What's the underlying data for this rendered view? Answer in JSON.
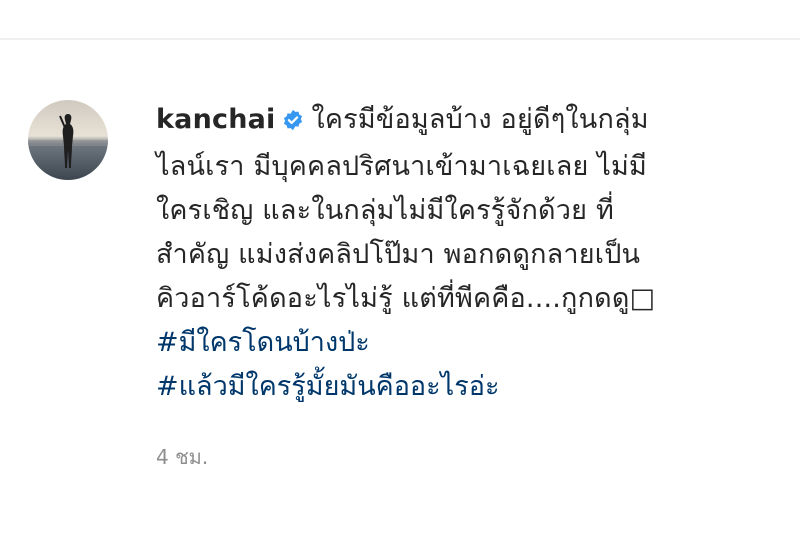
{
  "comment": {
    "username": "kanchai",
    "verified_icon": "verified-badge-icon",
    "lines": [
      "ใครมีข้อมูลบ้าง อยู่ดีๆในกลุ่ม",
      "ไลน์เรา มีบุคคลปริศนาเข้ามาเฉยเลย ไม่มี",
      "ใครเชิญ และในกลุ่มไม่มีใครรู้จักด้วย ที่",
      "สำคัญ แม่งส่งคลิปโป๊มา พอกดดูกลายเป็น",
      "คิวอาร์โค้ดอะไรไม่รู้ แต่ที่พีคคือ....กูกดดู□"
    ],
    "hashtags": [
      "#มีใครโดนบ้างป่ะ",
      "#แล้วมีใครรู้มั้ยมันคืออะไรอ่ะ"
    ],
    "time": "4 ชม."
  },
  "colors": {
    "text": "#262626",
    "hashtag": "#00376b",
    "meta": "#8e8e8e",
    "verified": "#3897f0"
  }
}
